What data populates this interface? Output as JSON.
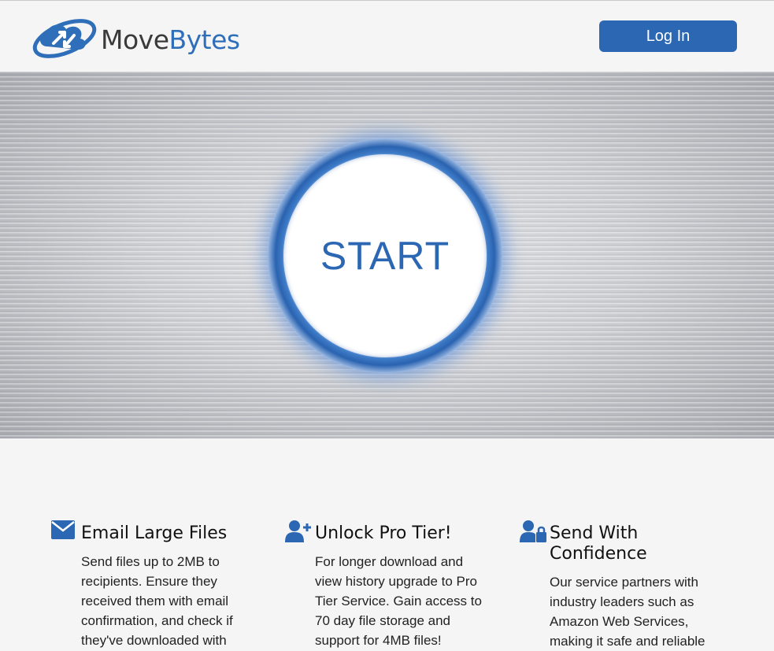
{
  "header": {
    "logo": {
      "move": "Move",
      "bytes": "Bytes"
    },
    "login_label": "Log In"
  },
  "hero": {
    "start_label": "START"
  },
  "features": [
    {
      "icon": "envelope-icon",
      "title": "Email Large Files",
      "body": "Send files up to 2MB to recipients. Ensure they received them with email confirmation, and check if they've downloaded with"
    },
    {
      "icon": "user-plus-icon",
      "title": "Unlock Pro Tier!",
      "body": "For longer download and view history upgrade to Pro Tier Service. Gain access to 70 day file storage and support for 4MB files!"
    },
    {
      "icon": "user-lock-icon",
      "title": "Send With Confidence",
      "body": "Our service partners with industry leaders such as Amazon Web Services, making it safe and reliable"
    }
  ],
  "colors": {
    "brand_blue": "#2b67b3",
    "logo_blue": "#2f6fba",
    "background": "#f5f5f5"
  }
}
